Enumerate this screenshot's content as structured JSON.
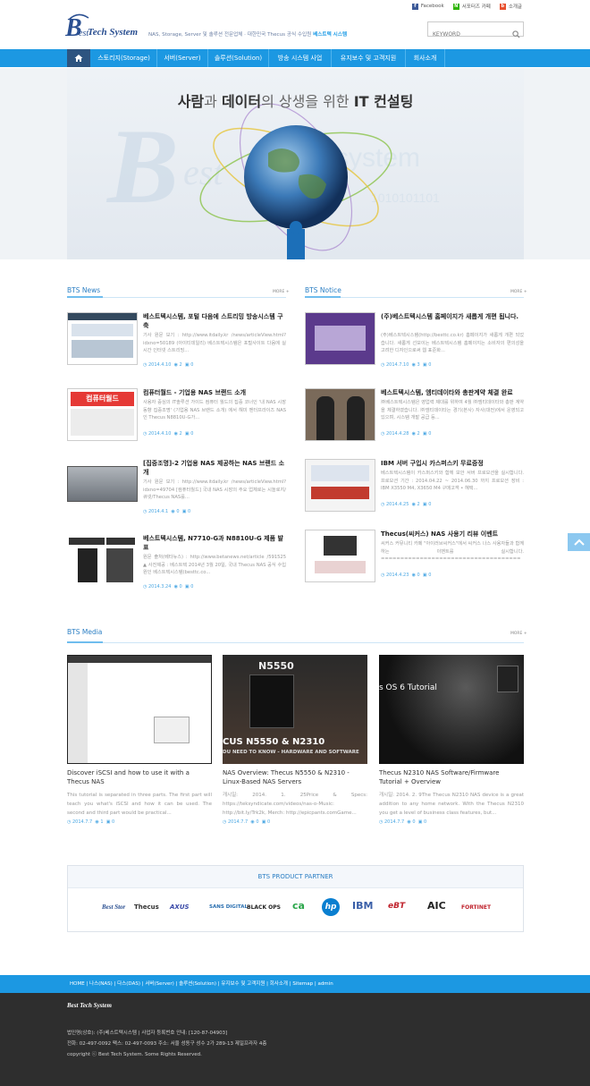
{
  "header": {
    "logo_text": "Tech System",
    "tagline_prefix": "NAS, Storage, Server 및 솔루션 전문업체 · 대한민국 Thecus 공식 수입원",
    "tagline_brand": "베스트텍 시스템",
    "toplinks": [
      {
        "icon": "facebook-icon",
        "label": "Facebook",
        "color": "#3b5998"
      },
      {
        "icon": "naver-cafe-icon",
        "label": "서포터즈 카페",
        "color": "#2db400"
      },
      {
        "icon": "blog-icon",
        "label": "소개글",
        "color": "#e8502e"
      }
    ],
    "search_placeholder": "KEYWORD"
  },
  "nav": {
    "items": [
      "스토리지(Storage)",
      "서버(Server)",
      "솔루션(Solution)",
      "방송 시스템 사업",
      "유지보수 및 고객지원",
      "회사소개"
    ]
  },
  "hero": {
    "title_part1": "사람",
    "title_part2": "과 ",
    "title_part3": "데이터",
    "title_part4": "의 상생을 위한 ",
    "title_part5": "IT 컨설팅"
  },
  "news": {
    "title": "BTS News",
    "more": "MORE +",
    "items": [
      {
        "title": "베스트텍시스템, 포털 다음에 스트리밍 방송시스템 구축",
        "desc": "기사 원문 보기 : http://www.itdaily.kr /news/articleView.html?idxno=50189 (아이티데일리) 베스트텍시스템은 포털사이트 다음에 실시간 인터넷 스트리밍...",
        "date": "2014.4.10",
        "views": "2",
        "comments": "0"
      },
      {
        "title": "컴퓨터월드 - 기업용 NAS 브랜드 소개",
        "desc": "사용자 중심의 IT솔루션 가이드 컴퓨터 월드의 집중 코너인 '내 NAS 시장 동향 집중조명' (기업용 NAS 브랜드 소개) 에서 해미 멘터프라이즈 NAS 인 Thecus N8810U-G가...",
        "date": "2014.4.10",
        "views": "2",
        "comments": "0"
      },
      {
        "title": "[집중조명]-2 기업용 NAS 제공하는 NAS 브랜드 소개",
        "desc": "기사 원문 보기 : http://www.itdaily.kr /news/articleView.html?idxno=49704 [컴퓨터월드] 국내 NAS 시장의 주요 업체로는 시놀로지/큐넷/Thecus NAS를...",
        "date": "2014.4.1",
        "views": "0",
        "comments": "0"
      },
      {
        "title": "베스트텍시스템, N7710-G과 N8810U-G 제품 발표",
        "desc": "원문 출처(베타뉴스) : http://www.betanews.net/article /591525 ▲ 사진제공 : 베스트텍 2014년 3월 20일, 국내 Thecus NAS 공식 수입원인 베스트텍시스템(besttc.co...",
        "date": "2014.3.24",
        "views": "0",
        "comments": "0"
      }
    ]
  },
  "notice": {
    "title": "BTS Notice",
    "more": "MORE +",
    "items": [
      {
        "title": "(주)베스트텍시스템 홈페이지가 새롭게 개편 됩니다.",
        "desc": "(주)베스트텍시스템(http://besttc.co.kr) 홈페이지가 새롭게 개편 되었습니다. 새롭게 선보이는 베스트텍시스템 홈페이지는 소비자의 편의성을 고려한 디자인으로써 웹 표준화...",
        "date": "2014.7.10",
        "views": "3",
        "comments": "0"
      },
      {
        "title": "베스트텍시스템, 엠티데이타와 총판계약 체결 완료",
        "desc": "㈜베스트텍시스템은 영업력 제대를 위하여 4월 ㈜엠티데이타와 총판 계약을 체결하였습니다. ㈜엠티데이타는 경기(본사) 자사(대전)에서 운영되고 있으며, 시스템 개발 공급 등...",
        "date": "2014.4.28",
        "views": "2",
        "comments": "0"
      },
      {
        "title": "IBM 서버 구입시 카스퍼스키 무료증정",
        "desc": "베스트텍시스템이 카스퍼스키와 함께 보안 서버 프로모션을 실시합니다. 프로모션 기간 : 2014.04.22 ~ 2014.06.30 까지 프로모션 장비 : IBM X3550 M4, X3650 M4 구매고객 • 혜택...",
        "date": "2014.4.25",
        "views": "2",
        "comments": "0"
      },
      {
        "title": "Thecus(씨커스) NAS 사용기 리뷰 이벤트",
        "desc": "씨커스 커뮤니티 카페 \"아이러브씨커스\"에서 씨커스 나스 사용자들과 함께하는 이벤트를 실시합니다. ==================================== Thecus...",
        "date": "2014.4.23",
        "views": "0",
        "comments": "0"
      }
    ]
  },
  "media": {
    "title": "BTS Media",
    "more": "MORE +",
    "items": [
      {
        "title": "Discover iSCSI and how to use it with a Thecus NAS",
        "desc": "This tutorial is separated in three parts. The first part will teach you what's iSCSI and how it can be used. The second and third part would be practical...",
        "date": "2014.7.7",
        "views": "1",
        "comments": "0",
        "overlay": ""
      },
      {
        "title": "NAS Overview: Thecus N5550 & N2310 - Linux-Based NAS Servers",
        "desc": "개시일: 2014. 1. 25Price & Specs: https://teksyndicate.com/videos/nas-o-Music: http://bit.ly/Trk2k, Merch: http://epicpants.comGame...",
        "date": "2014.7.7",
        "views": "0",
        "comments": "0",
        "overlay": "CUS N5550 & N2310",
        "overlay2": "DU NEED TO KNOW - HARDWARE AND SOFTWARE",
        "overlay_top": "N5550"
      },
      {
        "title": "Thecus N2310 NAS Software/Firmware Tutorial + Overview",
        "desc": "개시일: 2014. 2. 9The Thecus N2310 NAS device is a great addition to any home network. With the Thecus N2310 you get a level of business class features, but...",
        "date": "2014.7.7",
        "views": "0",
        "comments": "0",
        "overlay": "s OS 6 Tutorial"
      }
    ]
  },
  "partner": {
    "title": "BTS PRODUCT PARTNER",
    "logos": [
      {
        "name": "Best Stor",
        "color": "#2a4f91"
      },
      {
        "name": "Thecus",
        "color": "#333333"
      },
      {
        "name": "AXUS",
        "color": "#3a4aa8"
      },
      {
        "name": "SANS DIGITAL",
        "color": "#2a6fb0"
      },
      {
        "name": "BLACK OPS",
        "color": "#222222"
      },
      {
        "name": "ca",
        "color": "#2aa64a"
      },
      {
        "name": "hp",
        "color": "#0a7fd0"
      },
      {
        "name": "IBM",
        "color": "#3a5fa8"
      },
      {
        "name": "eBT",
        "color": "#c0242e"
      },
      {
        "name": "AIC",
        "color": "#222222"
      },
      {
        "name": "FORTINET",
        "color": "#c0242e"
      }
    ]
  },
  "footer": {
    "links": "HOME  |  나스(NAS)  |  다스(DAS)  |  서버(Server)  |  솔루션(Solution)  |  유지보수 및 고객지원  |  회사소개  |  Sitemap  |  admin",
    "logo": "Best Tech System",
    "line1": "법인명(상호): (주)베스트텍시스템 | 사업자 등록번호 안내: [120-87-04903]",
    "line2": "전화: 02-497-0092 팩스: 02-497-0093 주소: 서울 성동구 성수 2가 289-13 제일프라자 4층",
    "line3": "copyright ⓒ Best Tech System. Some Rights Reserved."
  },
  "colors": {
    "accent": "#1c98e2",
    "nav_home": "#2d5480",
    "footer_bg": "#2e2e2e"
  }
}
